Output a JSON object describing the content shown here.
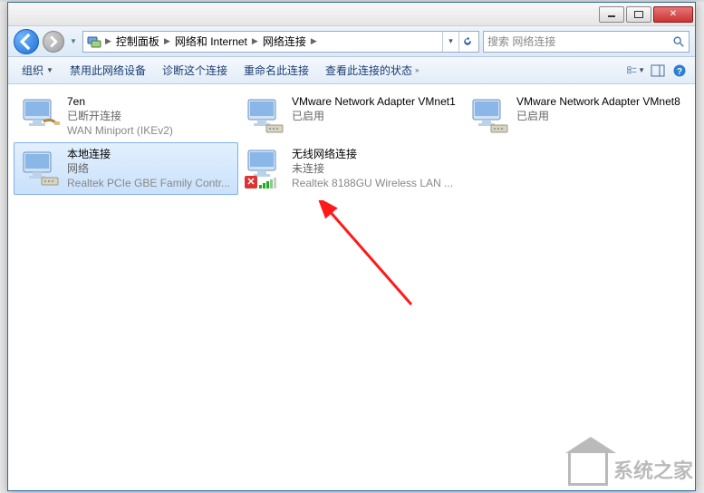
{
  "breadcrumb": {
    "root": "控制面板",
    "mid": "网络和 Internet",
    "leaf": "网络连接"
  },
  "search": {
    "placeholder": "搜索 网络连接"
  },
  "toolbar": {
    "organize": "组织",
    "disable": "禁用此网络设备",
    "diagnose": "诊断这个连接",
    "rename": "重命名此连接",
    "viewstatus": "查看此连接的状态"
  },
  "connections": [
    {
      "name": "7en",
      "status": "已断开连接",
      "device": "WAN Miniport (IKEv2)",
      "selected": false,
      "type": "disconnected"
    },
    {
      "name": "VMware Network Adapter VMnet1",
      "status": "已启用",
      "device": "",
      "selected": false,
      "type": "vm"
    },
    {
      "name": "VMware Network Adapter VMnet8",
      "status": "已启用",
      "device": "",
      "selected": false,
      "type": "vm"
    },
    {
      "name": "本地连接",
      "status": "网络",
      "device": "Realtek PCIe GBE Family Contr...",
      "selected": true,
      "type": "lan"
    },
    {
      "name": "无线网络连接",
      "status": "未连接",
      "device": "Realtek 8188GU Wireless LAN ...",
      "selected": false,
      "type": "wifi"
    }
  ],
  "watermark": "系统之家"
}
